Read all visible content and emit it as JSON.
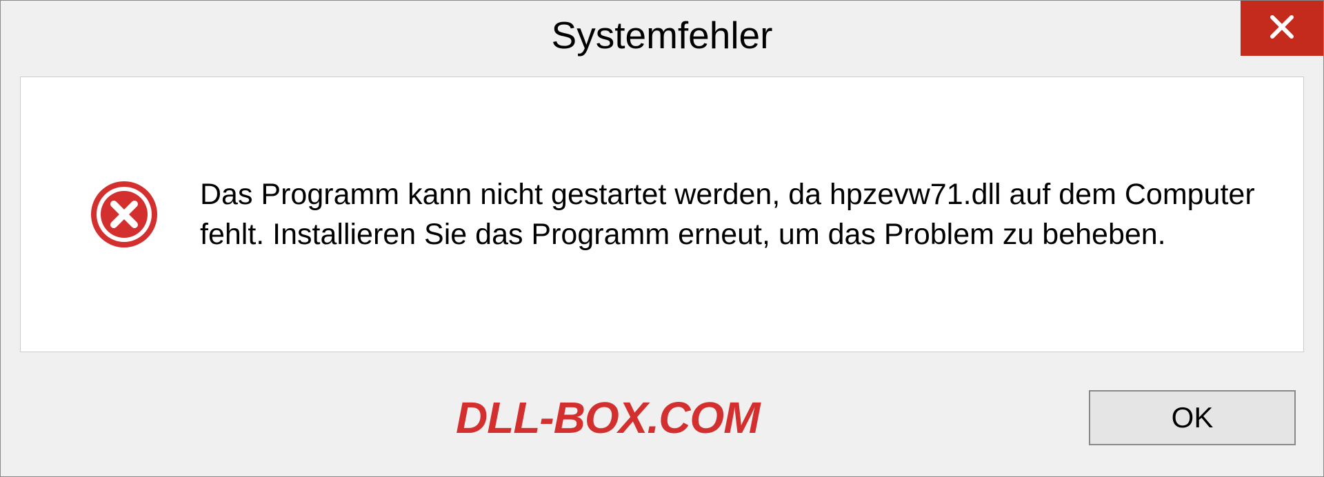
{
  "dialog": {
    "title": "Systemfehler",
    "message": "Das Programm kann nicht gestartet werden, da hpzevw71.dll auf dem Computer fehlt. Installieren Sie das Programm erneut, um das Problem zu beheben.",
    "ok_label": "OK"
  },
  "watermark": "DLL-BOX.COM",
  "icons": {
    "close": "close-icon",
    "error": "error-icon"
  },
  "colors": {
    "close_bg": "#c42b1c",
    "error_red": "#d32f2f",
    "panel_bg": "#ffffff",
    "dialog_bg": "#f0f0f0"
  }
}
